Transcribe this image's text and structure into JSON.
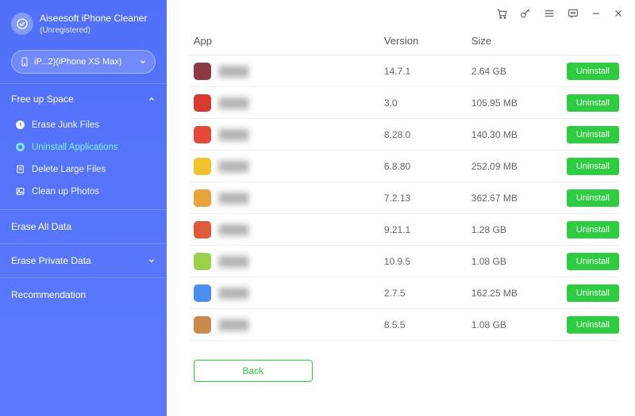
{
  "brand": {
    "title": "Aiseesoft iPhone Cleaner",
    "subtitle": "(Unregistered)"
  },
  "device": {
    "label": "iP...2)(iPhone XS Max)"
  },
  "sidebar": {
    "free_up_space": "Free up Space",
    "items": [
      {
        "label": "Erase Junk Files"
      },
      {
        "label": "Uninstall Applications"
      },
      {
        "label": "Delete Large Files"
      },
      {
        "label": "Clean up Photos"
      }
    ],
    "erase_all": "Erase All Data",
    "erase_private": "Erase Private Data",
    "recommendation": "Recommendation"
  },
  "table": {
    "headers": {
      "app": "App",
      "version": "Version",
      "size": "Size"
    },
    "uninstall_label": "Uninstall",
    "rows": [
      {
        "icon": "#8e3a44",
        "version": "14.7.1",
        "size": "2.64 GB"
      },
      {
        "icon": "#d63b2d",
        "version": "3.0",
        "size": "105.95 MB"
      },
      {
        "icon": "#e34b3a",
        "version": "8.28.0",
        "size": "140.30 MB"
      },
      {
        "icon": "#f0c22e",
        "version": "6.8.80",
        "size": "252.09 MB"
      },
      {
        "icon": "#e8a43a",
        "version": "7.2.13",
        "size": "362.67 MB"
      },
      {
        "icon": "#e05a3a",
        "version": "9.21.1",
        "size": "1.28 GB"
      },
      {
        "icon": "#9ad04a",
        "version": "10.9.5",
        "size": "1.08 GB"
      },
      {
        "icon": "#4a8ef0",
        "version": "2.7.5",
        "size": "162.25 MB"
      },
      {
        "icon": "#c98b4a",
        "version": "8.5.5",
        "size": "1.08 GB"
      }
    ]
  },
  "footer": {
    "back": "Back"
  }
}
